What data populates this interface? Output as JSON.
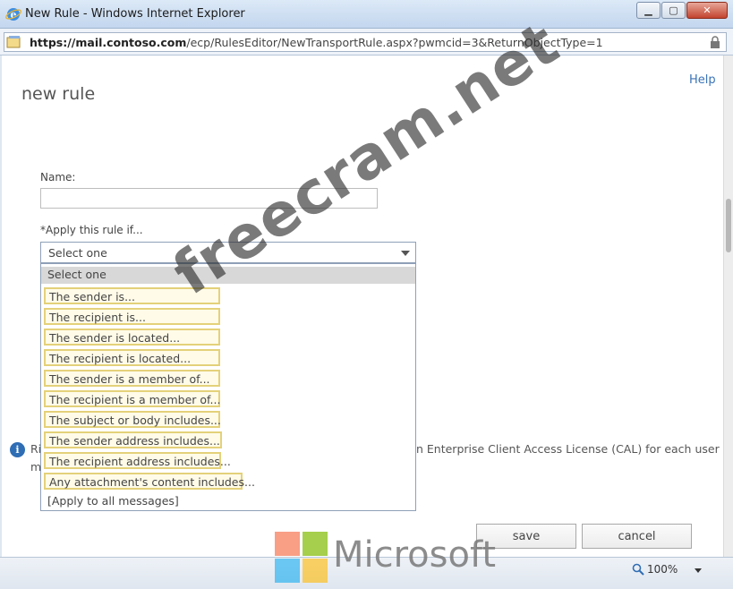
{
  "window": {
    "title": "New Rule - Windows Internet Explorer"
  },
  "addressbar": {
    "url_host": "https://mail.contoso.com",
    "url_path": "/ecp/RulesEditor/NewTransportRule.aspx?pwmcid=3&ReturnObjectType=1"
  },
  "page": {
    "title": "new rule",
    "help": "Help",
    "name_label": "Name:",
    "name_value": "",
    "apply_label": "*Apply this rule if...",
    "select_value": "Select one",
    "options": [
      "Select one",
      "The sender is...",
      "The recipient is...",
      "The sender is located...",
      "The recipient is located...",
      "The sender is a member of...",
      "The recipient is a member of...",
      "The subject or body includes...",
      "The sender address includes...",
      "The recipient address includes...",
      "Any attachment's content includes...",
      "[Apply to all messages]"
    ],
    "info_prefix": "Ri",
    "info_prefix2": "m",
    "info_text": "n Enterprise Client Access License (CAL) for each user",
    "save_label": "save",
    "cancel_label": "cancel"
  },
  "statusbar": {
    "zoom": "100%"
  },
  "watermark": {
    "site": "freecram.net",
    "brand": "Microsoft"
  },
  "colors": {
    "highlight_border": "#e4d17a",
    "link": "#3a73b8",
    "ms_red": "#f25022",
    "ms_green": "#7fba00",
    "ms_blue": "#00a4ef",
    "ms_yellow": "#ffb900"
  }
}
